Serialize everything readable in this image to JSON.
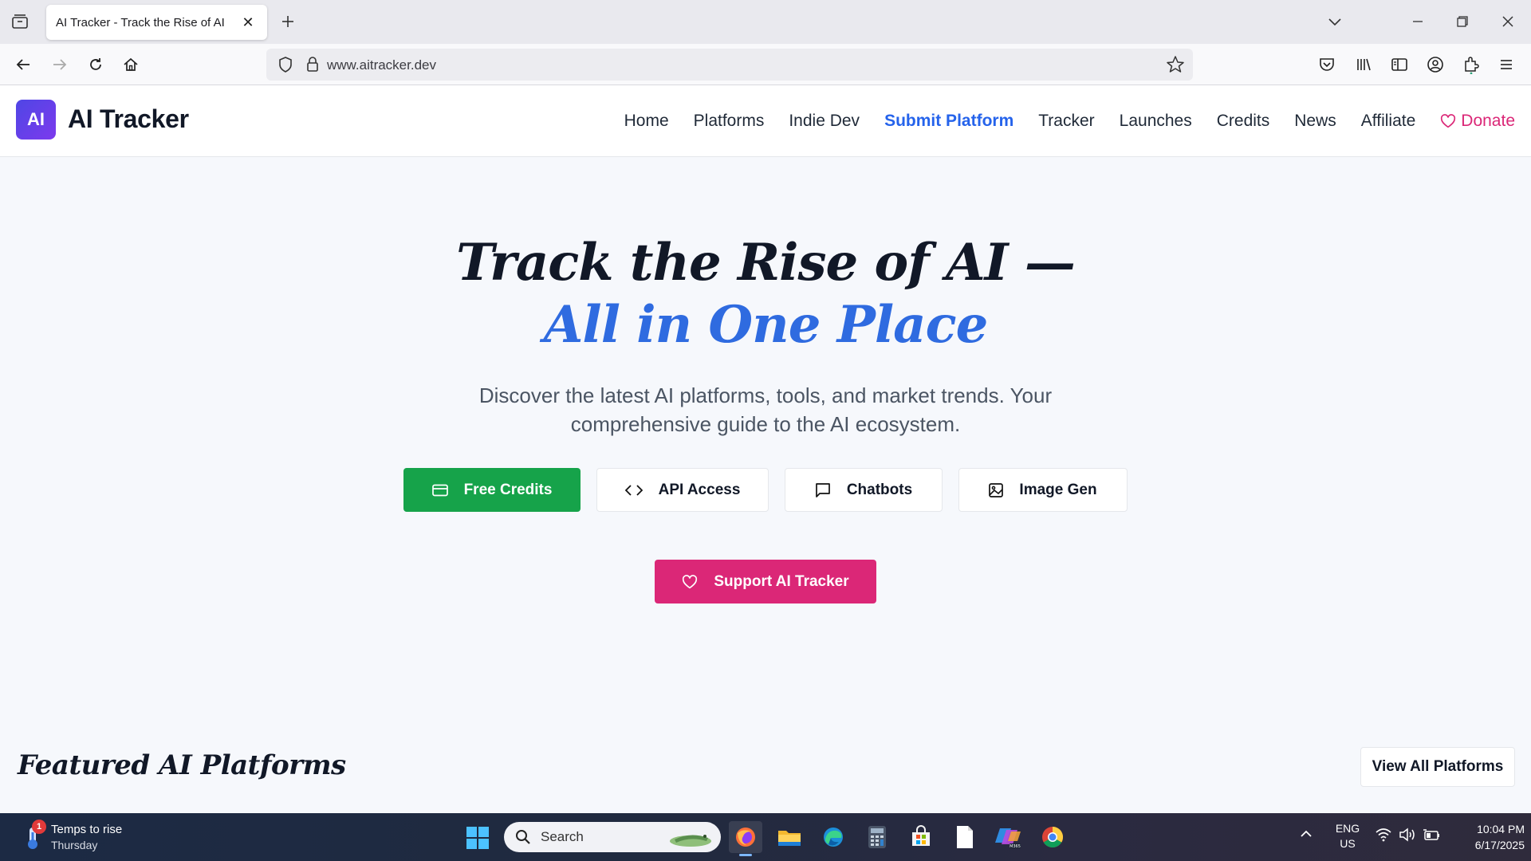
{
  "browser": {
    "tab_title": "AI Tracker - Track the Rise of AI",
    "url": "www.aitracker.dev"
  },
  "site": {
    "logo_badge": "AI",
    "logo_text": "AI Tracker",
    "nav": [
      "Home",
      "Platforms",
      "Indie Dev",
      "Submit Platform",
      "Tracker",
      "Launches",
      "Credits",
      "News",
      "Affiliate"
    ],
    "donate": "Donate"
  },
  "hero": {
    "line1": "Track the Rise of AI —",
    "line2": "All in One Place",
    "subtitle": "Discover the latest AI platforms, tools, and market trends. Your comprehensive guide to the AI ecosystem.",
    "buttons": [
      "Free Credits",
      "API Access",
      "Chatbots",
      "Image Gen"
    ],
    "support": "Support AI Tracker"
  },
  "featured": {
    "title": "Featured AI Platforms",
    "view_all": "View All Platforms"
  },
  "taskbar": {
    "weather_title": "Temps to rise",
    "weather_sub": "Thursday",
    "weather_badge": "1",
    "search_placeholder": "Search",
    "lang1": "ENG",
    "lang2": "US",
    "time": "10:04 PM",
    "date": "6/17/2025"
  },
  "colors": {
    "accent_blue": "#2563eb",
    "green": "#16a34a",
    "pink": "#db2777",
    "logo_gradient_start": "#4f46e5",
    "logo_gradient_end": "#7c3aed"
  }
}
